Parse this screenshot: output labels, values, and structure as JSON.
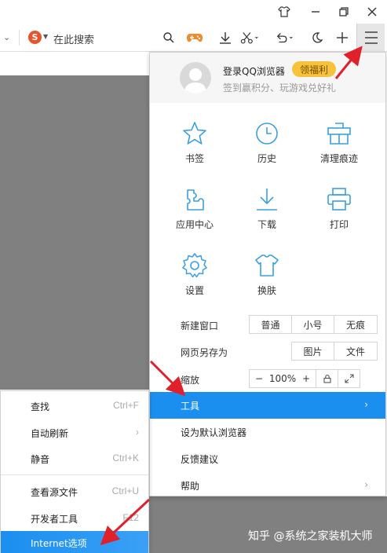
{
  "titlebar": {
    "icons": [
      "shirt-icon",
      "minimize-icon",
      "restore-icon",
      "close-icon"
    ]
  },
  "toolbar": {
    "search_engine_letter": "S",
    "search_placeholder": "在此搜索",
    "icons": [
      "search-icon",
      "game-icon",
      "download-icon",
      "scissors-icon",
      "undo-icon",
      "moon-icon",
      "plus-icon",
      "menu-icon"
    ]
  },
  "profile": {
    "login_text": "登录QQ浏览器",
    "badge": "领福利",
    "sign_text": "签到赢积分、玩游戏兑好礼"
  },
  "grid": [
    {
      "label": "书签",
      "icon": "star-icon"
    },
    {
      "label": "历史",
      "icon": "clock-icon"
    },
    {
      "label": "清理痕迹",
      "icon": "clean-icon"
    },
    {
      "label": "应用中心",
      "icon": "puzzle-icon"
    },
    {
      "label": "下载",
      "icon": "download-icon"
    },
    {
      "label": "打印",
      "icon": "printer-icon"
    },
    {
      "label": "设置",
      "icon": "gear-icon"
    },
    {
      "label": "换肤",
      "icon": "shirt-icon"
    }
  ],
  "new_window": {
    "label": "新建窗口",
    "options": [
      "普通",
      "小号",
      "无痕"
    ]
  },
  "save_as": {
    "label": "网页另存为",
    "options": [
      "图片",
      "文件"
    ]
  },
  "zoom": {
    "label": "缩放",
    "minus": "−",
    "value": "100%",
    "plus": "+"
  },
  "menu_items": [
    {
      "label": "工具",
      "arrow": "›",
      "active": true
    },
    {
      "label": "设为默认浏览器",
      "arrow": ""
    },
    {
      "label": "反馈建议",
      "arrow": ""
    },
    {
      "label": "帮助",
      "arrow": "›"
    }
  ],
  "sub_menu": [
    {
      "label": "查找",
      "shortcut": "Ctrl+F"
    },
    {
      "label": "自动刷新",
      "shortcut": "›"
    },
    {
      "label": "静音",
      "shortcut": "Ctrl+K"
    },
    {
      "label": "查看源文件",
      "shortcut": "Ctrl+U"
    },
    {
      "label": "开发者工具",
      "shortcut": "F12"
    },
    {
      "label": "Internet选项",
      "shortcut": ""
    }
  ],
  "watermark": "知乎 @系统之家装机大师",
  "colors": {
    "accent_blue": "#1a8ff0",
    "icon_blue": "#3a9fe0",
    "badge_yellow": "#f6c33a",
    "arrow_red": "#e0202a",
    "page_gray": "#808080"
  }
}
